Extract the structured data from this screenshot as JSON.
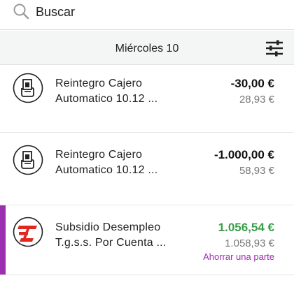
{
  "search": {
    "placeholder": "Buscar",
    "icon": "search-icon"
  },
  "date_header": {
    "label": "Miércoles 10",
    "filter_icon": "sliders-icon"
  },
  "colors": {
    "accent": "#9b2fae",
    "positive": "#3a9d4a",
    "bank_red": "#e0281f"
  },
  "transactions": [
    {
      "icon": "atm-withdrawal-icon",
      "title_line1": "Reintegro Cajero",
      "title_line2": "Automatico 10.12 ...",
      "amount": "-30,00 €",
      "balance": "28,93 €"
    },
    {
      "icon": "atm-withdrawal-icon",
      "title_line1": "Reintegro Cajero",
      "title_line2": "Automatico 10.12 ...",
      "amount": "-1.000,00 €",
      "balance": "58,93 €"
    },
    {
      "icon": "bank-logo-icon",
      "title_line1": "Subsidio Desempleo",
      "title_line2": "T.g.s.s. Por Cuenta ...",
      "amount": "1.056,54 €",
      "balance": "1.058,93 €",
      "action": "Ahorrar una parte"
    }
  ]
}
